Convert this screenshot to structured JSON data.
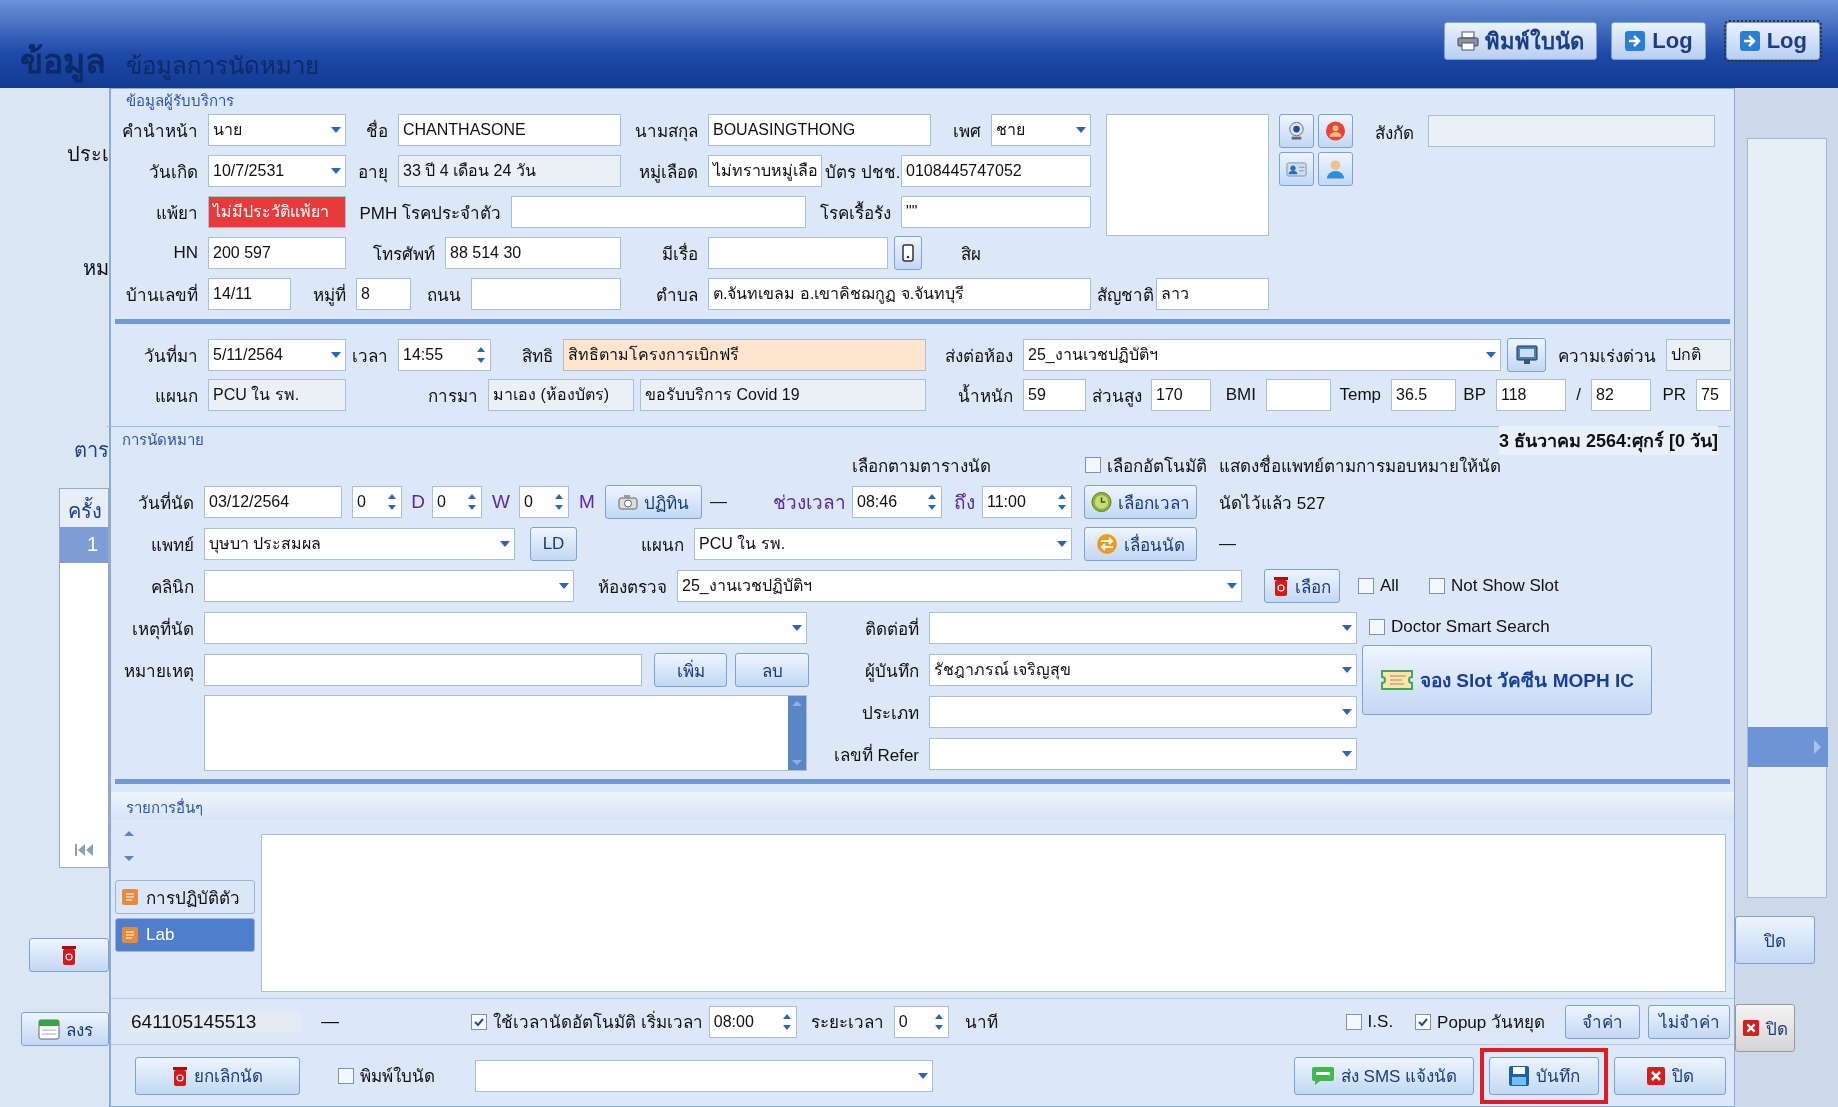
{
  "window": {
    "app_title": "ข้อมูล",
    "title": "ข้อมูลการนัดหมาย",
    "buttons": [
      "พิมพ์ใบนัด",
      "Log"
    ],
    "back_button": "Log"
  },
  "background_window": {
    "labels": [
      "ประเ",
      "หม"
    ],
    "tab": "ตาร",
    "table_header": "ครั้ง",
    "table_row": {
      "cell": "1",
      "selected": true
    },
    "bottom_button": "ลงร",
    "close_buttons": [
      "ปิด",
      "ปิด"
    ]
  },
  "tab": "ข้อมูลผู้รับบริการ",
  "patient": {
    "rows": [
      {
        "items": [
          {
            "kind": "label",
            "text": "คำนำหน้า"
          },
          {
            "kind": "dropdown",
            "value": "นาย"
          },
          {
            "kind": "label",
            "text": "ชื่อ"
          },
          {
            "kind": "field",
            "value": "CHANTHASONE"
          },
          {
            "kind": "label",
            "text": "นามสกุล"
          },
          {
            "kind": "field",
            "value": "BOUASINGTHONG"
          },
          {
            "kind": "label",
            "text": "เพศ"
          },
          {
            "kind": "dropdown",
            "value": "ชาย"
          }
        ]
      },
      {
        "items": [
          {
            "kind": "label",
            "text": "วันเกิด"
          },
          {
            "kind": "dropdown",
            "value": "10/7/2531"
          },
          {
            "kind": "label",
            "text": "อายุ"
          },
          {
            "kind": "readonly",
            "value": "33 ปี 4 เดือน 24 วัน"
          },
          {
            "kind": "label",
            "text": "หมู่เลือด"
          },
          {
            "kind": "field",
            "value": "ไม่ทราบหมู่เลือ"
          },
          {
            "kind": "label",
            "text": "บัตร ปชช."
          },
          {
            "kind": "field",
            "value": "0108445747052"
          }
        ]
      },
      {
        "items": [
          {
            "kind": "label",
            "text": "แพ้ยา"
          },
          {
            "kind": "alert-field",
            "value": "ไม่มีประวัติแพ้ยา"
          },
          {
            "kind": "label",
            "text": "PMH โรคประจำตัว"
          },
          {
            "kind": "field"
          },
          {
            "kind": "label",
            "text": "โรคเรื้อรัง"
          },
          {
            "kind": "field",
            "value": "\"\""
          }
        ]
      },
      {
        "items": [
          {
            "kind": "label",
            "text": "HN"
          },
          {
            "kind": "field",
            "value": "200 597"
          },
          {
            "kind": "label",
            "text": "โทรศัพท์"
          },
          {
            "kind": "field",
            "value": "88 514 30"
          },
          {
            "kind": "label",
            "text": "มีเรื่อ"
          },
          {
            "kind": "field"
          },
          {
            "kind": "icon-button"
          },
          {
            "kind": "label",
            "text": "สิผ"
          }
        ]
      }
    ],
    "affiliation_label": "สังกัด",
    "address_row": {
      "items": [
        {
          "kind": "label",
          "text": "บ้านเลขที่"
        },
        {
          "kind": "field",
          "value": "14/11"
        },
        {
          "kind": "label",
          "text": "หมู่ที่"
        },
        {
          "kind": "field",
          "value": "8"
        },
        {
          "kind": "label",
          "text": "ถนน"
        },
        {
          "kind": "field"
        },
        {
          "kind": "label",
          "text": "ตำบล"
        },
        {
          "kind": "field",
          "value": "ต.จันทเขลม อ.เขาคิชฌกูฏ จ.จันทบุรี"
        },
        {
          "kind": "label",
          "text": "สัญชาติ"
        },
        {
          "kind": "field",
          "value": "ลาว"
        }
      ]
    }
  },
  "visit": {
    "rows": [
      {
        "items": [
          {
            "kind": "label",
            "text": "วันที่มา"
          },
          {
            "kind": "dropdown",
            "value": "5/11/2564"
          },
          {
            "kind": "label",
            "text": "เวลา"
          },
          {
            "kind": "spin",
            "value": "14:55"
          },
          {
            "kind": "label",
            "text": "สิทธิ"
          },
          {
            "kind": "rights-field",
            "value": "สิทธิตามโครงการเบิกฟรี"
          },
          {
            "kind": "label",
            "text": "ส่งต่อห้อง"
          },
          {
            "kind": "dropdown",
            "value": "25_งานเวชปฏิบัติฯ"
          },
          {
            "kind": "icon-button"
          },
          {
            "kind": "label",
            "text": "ความเร่งด่วน"
          },
          {
            "kind": "readonly",
            "value": "ปกติ"
          }
        ]
      },
      {
        "items": [
          {
            "kind": "label",
            "text": "แผนก"
          },
          {
            "kind": "readonly",
            "value": "PCU ใน รพ."
          },
          {
            "kind": "label",
            "text": "การมา"
          },
          {
            "kind": "readonly",
            "value": "มาเอง (ห้องบัตร)"
          },
          {
            "kind": "readonly",
            "value": "ขอรับบริการ Covid 19"
          },
          {
            "kind": "label",
            "text": "น้ำหนัก"
          },
          {
            "kind": "field",
            "value": "59"
          },
          {
            "kind": "label",
            "text": "ส่วนสูง"
          },
          {
            "kind": "field",
            "value": "170"
          },
          {
            "kind": "label",
            "text": "BMI"
          },
          {
            "kind": "field"
          },
          {
            "kind": "label",
            "text": "Temp"
          },
          {
            "kind": "field",
            "value": "36.5"
          },
          {
            "kind": "label",
            "text": "BP"
          },
          {
            "kind": "field",
            "value": "118"
          },
          {
            "kind": "label",
            "text": "/"
          },
          {
            "kind": "field",
            "value": "82"
          },
          {
            "kind": "label",
            "text": "PR"
          },
          {
            "kind": "field",
            "value": "75"
          }
        ]
      }
    ]
  },
  "appointment": {
    "title": "การนัดหมาย",
    "date_summary": "3 ธันวาคม 2564:ศุกร์  [0 วัน]",
    "options_row": {
      "items": [
        {
          "kind": "text",
          "text": "เลือกตามตารางนัด"
        },
        {
          "kind": "check",
          "label": "เลือกอัตโนมัติ",
          "checked": false
        },
        {
          "kind": "text",
          "text": "แสดงชื่อแพทย์ตามการมอบหมายให้นัด"
        }
      ]
    },
    "rows": [
      {
        "items": [
          {
            "kind": "label",
            "text": "วันที่นัด"
          },
          {
            "kind": "field",
            "value": "03/12/2564"
          },
          {
            "kind": "spin",
            "value": "0"
          },
          {
            "kind": "unit",
            "text": "D"
          },
          {
            "kind": "spin",
            "value": "0"
          },
          {
            "kind": "unit",
            "text": "W"
          },
          {
            "kind": "spin",
            "value": "0"
          },
          {
            "kind": "unit",
            "text": "M"
          },
          {
            "kind": "button",
            "label": "ปฏิทิน"
          },
          {
            "kind": "text",
            "text": "—"
          },
          {
            "kind": "unit",
            "text": "ช่วงเวลา"
          },
          {
            "kind": "spin",
            "value": "08:46"
          },
          {
            "kind": "unit",
            "text": "ถึง"
          },
          {
            "kind": "spin",
            "value": "11:00"
          },
          {
            "kind": "button",
            "label": "เลือกเวลา"
          },
          {
            "kind": "text",
            "text": "นัดไว้แล้ว   527"
          }
        ]
      },
      {
        "items": [
          {
            "kind": "label",
            "text": "แพทย์"
          },
          {
            "kind": "dropdown",
            "value": "บุษบา  ประสมผล"
          },
          {
            "kind": "button",
            "label": "LD"
          },
          {
            "kind": "label",
            "text": "แผนก"
          },
          {
            "kind": "dropdown",
            "value": "PCU ใน รพ."
          },
          {
            "kind": "button",
            "label": "เลื่อนนัด"
          },
          {
            "kind": "text",
            "text": "—"
          }
        ]
      },
      {
        "items": [
          {
            "kind": "label",
            "text": "คลินิก"
          },
          {
            "kind": "dropdown"
          },
          {
            "kind": "label",
            "text": "ห้องตรวจ"
          },
          {
            "kind": "dropdown",
            "value": "25_งานเวชปฏิบัติฯ"
          },
          {
            "kind": "button",
            "label": "เลือก"
          },
          {
            "kind": "check",
            "label": "All",
            "checked": false
          },
          {
            "kind": "check",
            "label": "Not Show Slot",
            "checked": false
          }
        ]
      }
    ],
    "left_rows": [
      {
        "items": [
          {
            "kind": "label",
            "text": "เหตุที่นัด"
          },
          {
            "kind": "dropdown"
          }
        ]
      },
      {
        "items": [
          {
            "kind": "label",
            "text": "หมายเหตุ"
          },
          {
            "kind": "field"
          },
          {
            "kind": "button",
            "label": "เพิ่ม"
          },
          {
            "kind": "button",
            "label": "ลบ"
          }
        ]
      }
    ],
    "middle_rows": [
      {
        "items": [
          {
            "kind": "label",
            "text": "ติดต่อที่"
          },
          {
            "kind": "dropdown"
          }
        ]
      },
      {
        "items": [
          {
            "kind": "label",
            "text": "ผู้บันทึก"
          },
          {
            "kind": "dropdown",
            "value": "รัชฎาภรณ์  เจริญสุข"
          }
        ]
      },
      {
        "items": [
          {
            "kind": "label",
            "text": "ประเภท"
          },
          {
            "kind": "dropdown"
          }
        ]
      },
      {
        "items": [
          {
            "kind": "label",
            "text": "เลขที่ Refer"
          },
          {
            "kind": "dropdown"
          }
        ]
      }
    ],
    "doctor_smart_search": {
      "label": "Doctor Smart Search",
      "checked": false
    },
    "slot_button": "จอง Slot วัคซีน MOPH IC"
  },
  "other": {
    "title": "รายการอื่นๆ",
    "menu": [
      {
        "label": "การปฏิบัติตัว",
        "selected": false
      },
      {
        "label": "Lab",
        "selected": true
      }
    ]
  },
  "status": {
    "visit_number": "641105145513",
    "dash": "—",
    "auto_time": {
      "label": "ใช้เวลานัดอัตโนมัติ เริ่มเวลา",
      "checked": true
    },
    "start_time": "08:00",
    "duration_label": "ระยะเวลา",
    "duration": "0",
    "unit": "นาที",
    "is": {
      "label": "I.S.",
      "checked": false
    },
    "holiday_popup": {
      "label": "Popup วันหยุด",
      "checked": true
    },
    "buttons": [
      "จำค่า",
      "ไม่จำค่า"
    ]
  },
  "footer": {
    "cancel": "ยกเลิกนัด",
    "print": {
      "label": "พิมพ์ใบนัด",
      "checked": false
    },
    "sms": "ส่ง SMS แจ้งนัด",
    "save": {
      "label": "บันทึก",
      "highlighted": true
    },
    "close": "ปิด"
  }
}
